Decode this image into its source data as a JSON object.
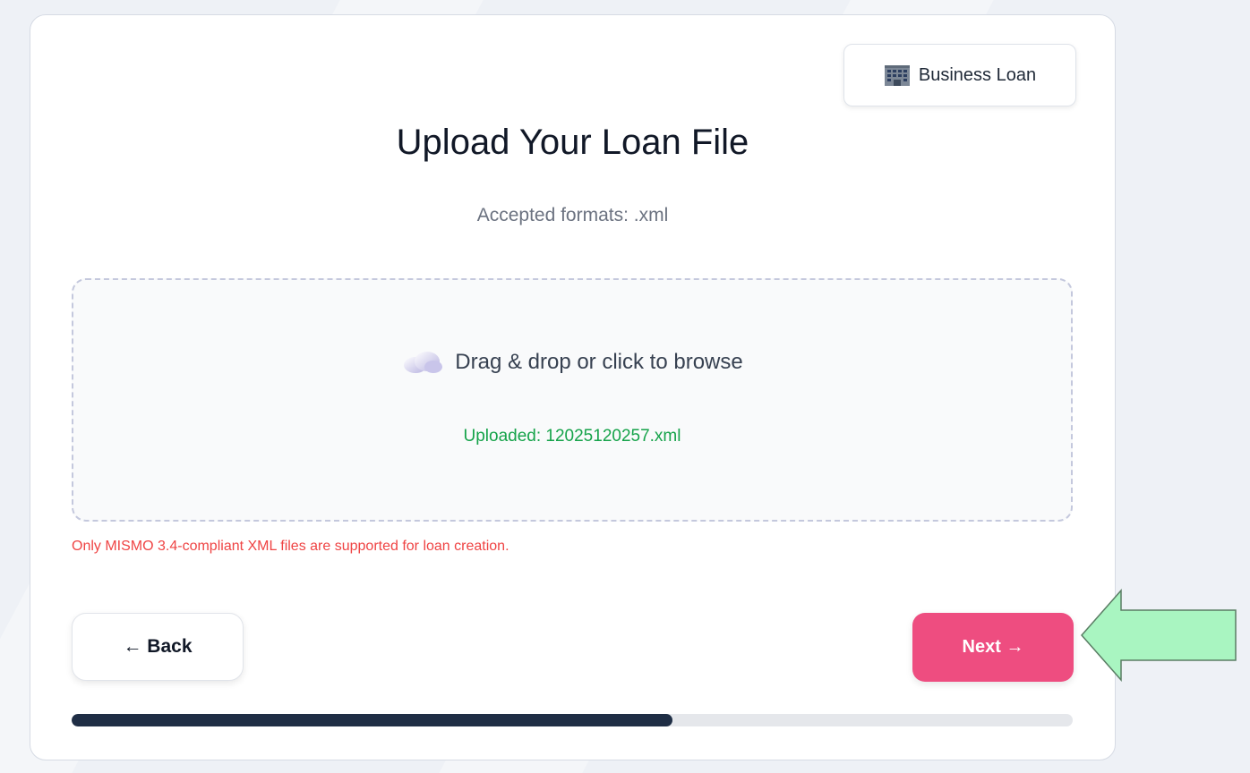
{
  "loan_type_badge": {
    "label": "Business Loan",
    "icon": "building-icon"
  },
  "upload": {
    "title": "Upload Your Loan File",
    "accepted_formats": "Accepted formats: .xml",
    "dropzone_icon": "cloud-icon",
    "dropzone_label": "Drag & drop or click to browse",
    "uploaded_text": "Uploaded: 12025120257.xml",
    "note": "Only MISMO 3.4-compliant XML files are supported for loan creation."
  },
  "navigation": {
    "back_label": "← Back",
    "next_label": "Next →"
  },
  "progress": {
    "value": 0.6
  },
  "colors": {
    "accent": "#ee4d80",
    "success": "#16a34a",
    "warning": "#ef4444",
    "progress_fill": "#1f2e45",
    "pointer_arrow": "#a9f5c1"
  }
}
